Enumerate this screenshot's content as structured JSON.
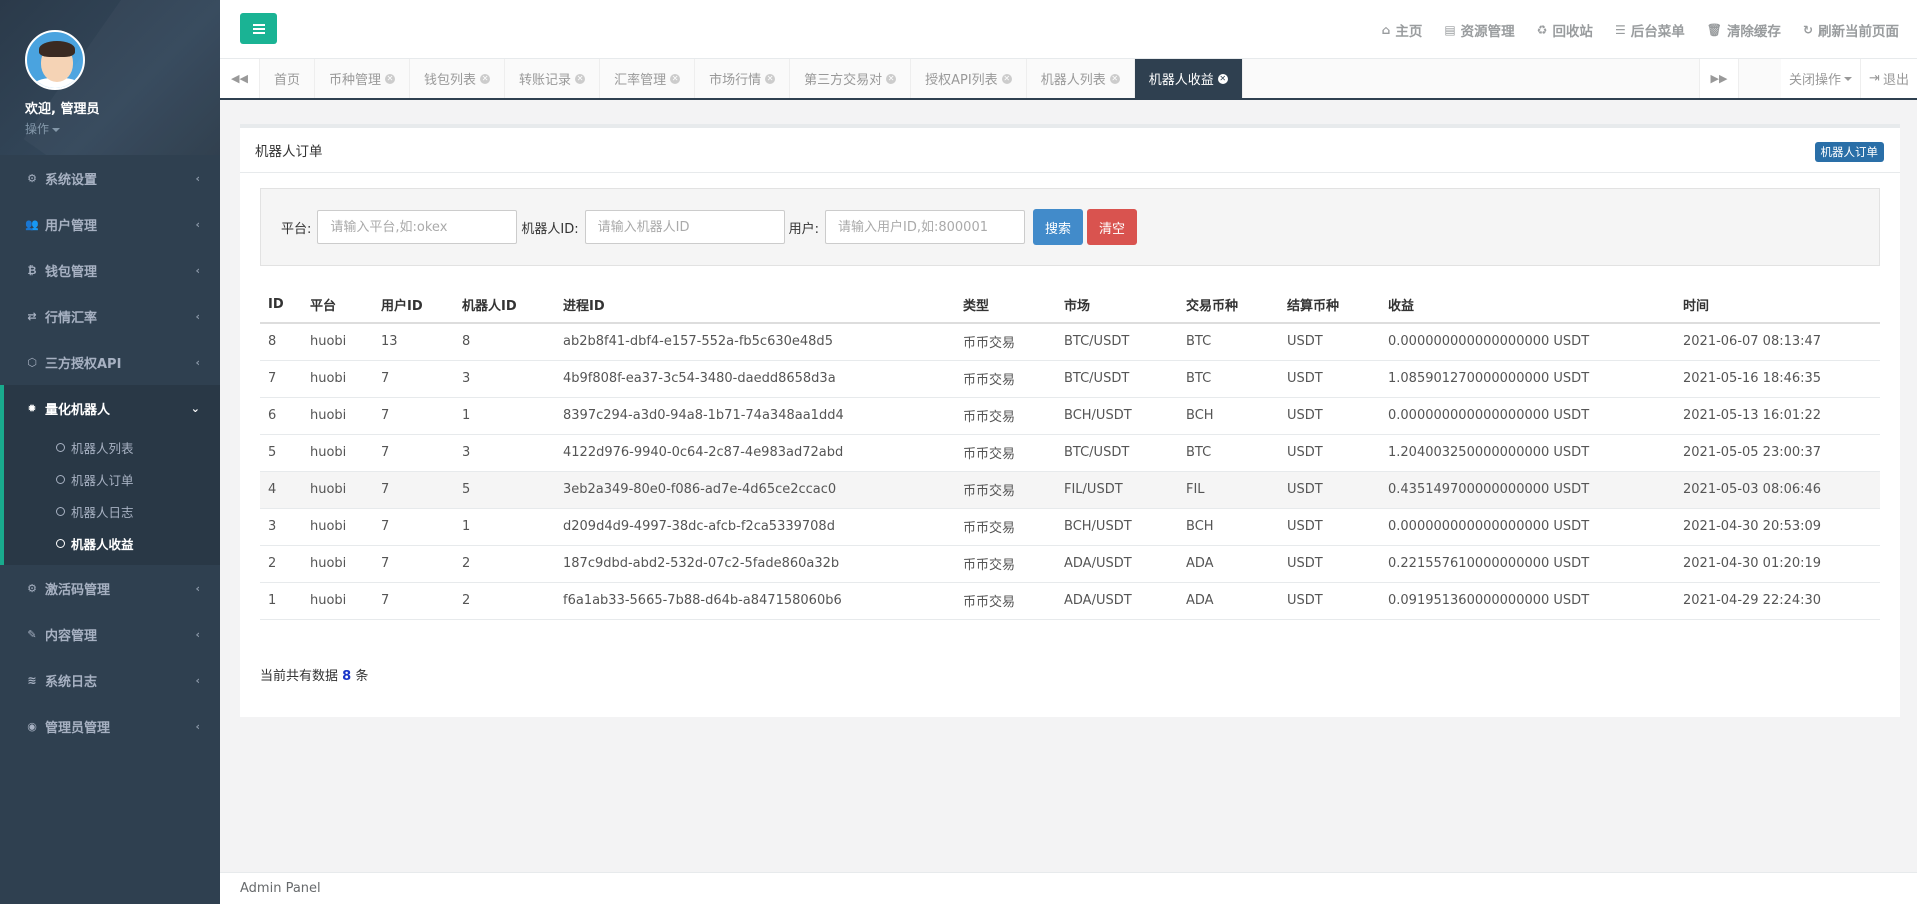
{
  "profile": {
    "welcome": "欢迎, 管理员",
    "ops": "操作"
  },
  "sidebar": {
    "items": [
      {
        "label": "系统设置",
        "icon": "gears-icon"
      },
      {
        "label": "用户管理",
        "icon": "users-icon"
      },
      {
        "label": "钱包管理",
        "icon": "bitcoin-icon"
      },
      {
        "label": "行情汇率",
        "icon": "exchange-icon"
      },
      {
        "label": "三方授权API",
        "icon": "dropbox-icon"
      }
    ],
    "active_group": {
      "label": "量化机器人",
      "icon": "bug-icon",
      "children": [
        "机器人列表",
        "机器人订单",
        "机器人日志",
        "机器人收益"
      ]
    },
    "items_after": [
      {
        "label": "激活码管理",
        "icon": "gear-icon"
      },
      {
        "label": "内容管理",
        "icon": "edit-icon"
      },
      {
        "label": "系统日志",
        "icon": "database-icon"
      },
      {
        "label": "管理员管理",
        "icon": "user-circle-icon"
      }
    ]
  },
  "topbar": {
    "links": [
      {
        "label": "主页",
        "icon": "⌂"
      },
      {
        "label": "资源管理",
        "icon": "▤"
      },
      {
        "label": "回收站",
        "icon": "♻"
      },
      {
        "label": "后台菜单",
        "icon": "☰"
      },
      {
        "label": "清除缓存",
        "icon": "🗑"
      },
      {
        "label": "刷新当前页面",
        "icon": "↻"
      }
    ]
  },
  "tabs": {
    "items": [
      "首页",
      "币种管理",
      "钱包列表",
      "转账记录",
      "汇率管理",
      "市场行情",
      "第三方交易对",
      "授权API列表",
      "机器人列表",
      "机器人收益"
    ],
    "close_ops": "关闭操作",
    "logout": "退出"
  },
  "panel": {
    "title": "机器人订单",
    "badge": "机器人订单",
    "search": {
      "platform_label": "平台:",
      "platform_placeholder": "请输入平台,如:okex",
      "robot_label": "机器人ID:",
      "robot_placeholder": "请输入机器人ID",
      "user_label": "用户:",
      "user_placeholder": "请输入用户ID,如:800001",
      "search_btn": "搜索",
      "clear_btn": "清空"
    },
    "table": {
      "headers": [
        "ID",
        "平台",
        "用户ID",
        "机器人ID",
        "进程ID",
        "类型",
        "市场",
        "交易币种",
        "结算币种",
        "收益",
        "时间"
      ],
      "rows": [
        [
          "8",
          "huobi",
          "13",
          "8",
          "ab2b8f41-dbf4-e157-552a-fb5c630e48d5",
          "币币交易",
          "BTC/USDT",
          "BTC",
          "USDT",
          "0.000000000000000000 USDT",
          "2021-06-07 08:13:47"
        ],
        [
          "7",
          "huobi",
          "7",
          "3",
          "4b9f808f-ea37-3c54-3480-daedd8658d3a",
          "币币交易",
          "BTC/USDT",
          "BTC",
          "USDT",
          "1.085901270000000000 USDT",
          "2021-05-16 18:46:35"
        ],
        [
          "6",
          "huobi",
          "7",
          "1",
          "8397c294-a3d0-94a8-1b71-74a348aa1dd4",
          "币币交易",
          "BCH/USDT",
          "BCH",
          "USDT",
          "0.000000000000000000 USDT",
          "2021-05-13 16:01:22"
        ],
        [
          "5",
          "huobi",
          "7",
          "3",
          "4122d976-9940-0c64-2c87-4e983ad72abd",
          "币币交易",
          "BTC/USDT",
          "BTC",
          "USDT",
          "1.204003250000000000 USDT",
          "2021-05-05 23:00:37"
        ],
        [
          "4",
          "huobi",
          "7",
          "5",
          "3eb2a349-80e0-f086-ad7e-4d65ce2ccac0",
          "币币交易",
          "FIL/USDT",
          "FIL",
          "USDT",
          "0.435149700000000000 USDT",
          "2021-05-03 08:06:46"
        ],
        [
          "3",
          "huobi",
          "7",
          "1",
          "d209d4d9-4997-38dc-afcb-f2ca5339708d",
          "币币交易",
          "BCH/USDT",
          "BCH",
          "USDT",
          "0.000000000000000000 USDT",
          "2021-04-30 20:53:09"
        ],
        [
          "2",
          "huobi",
          "7",
          "2",
          "187c9dbd-abd2-532d-07c2-5fade860a32b",
          "币币交易",
          "ADA/USDT",
          "ADA",
          "USDT",
          "0.221557610000000000 USDT",
          "2021-04-30 01:20:19"
        ],
        [
          "1",
          "huobi",
          "7",
          "2",
          "f6a1ab33-5665-7b88-d64b-a847158060b6",
          "币币交易",
          "ADA/USDT",
          "ADA",
          "USDT",
          "0.091951360000000000 USDT",
          "2021-04-29 22:24:30"
        ]
      ]
    },
    "total_prefix": "当前共有数据",
    "total_count": "8",
    "total_suffix": "条"
  },
  "footer": {
    "text": "Admin Panel"
  },
  "colors": {
    "sidebar": "#2f4050",
    "accent": "#1ab394",
    "primary": "#428bca",
    "danger": "#d9534f"
  }
}
